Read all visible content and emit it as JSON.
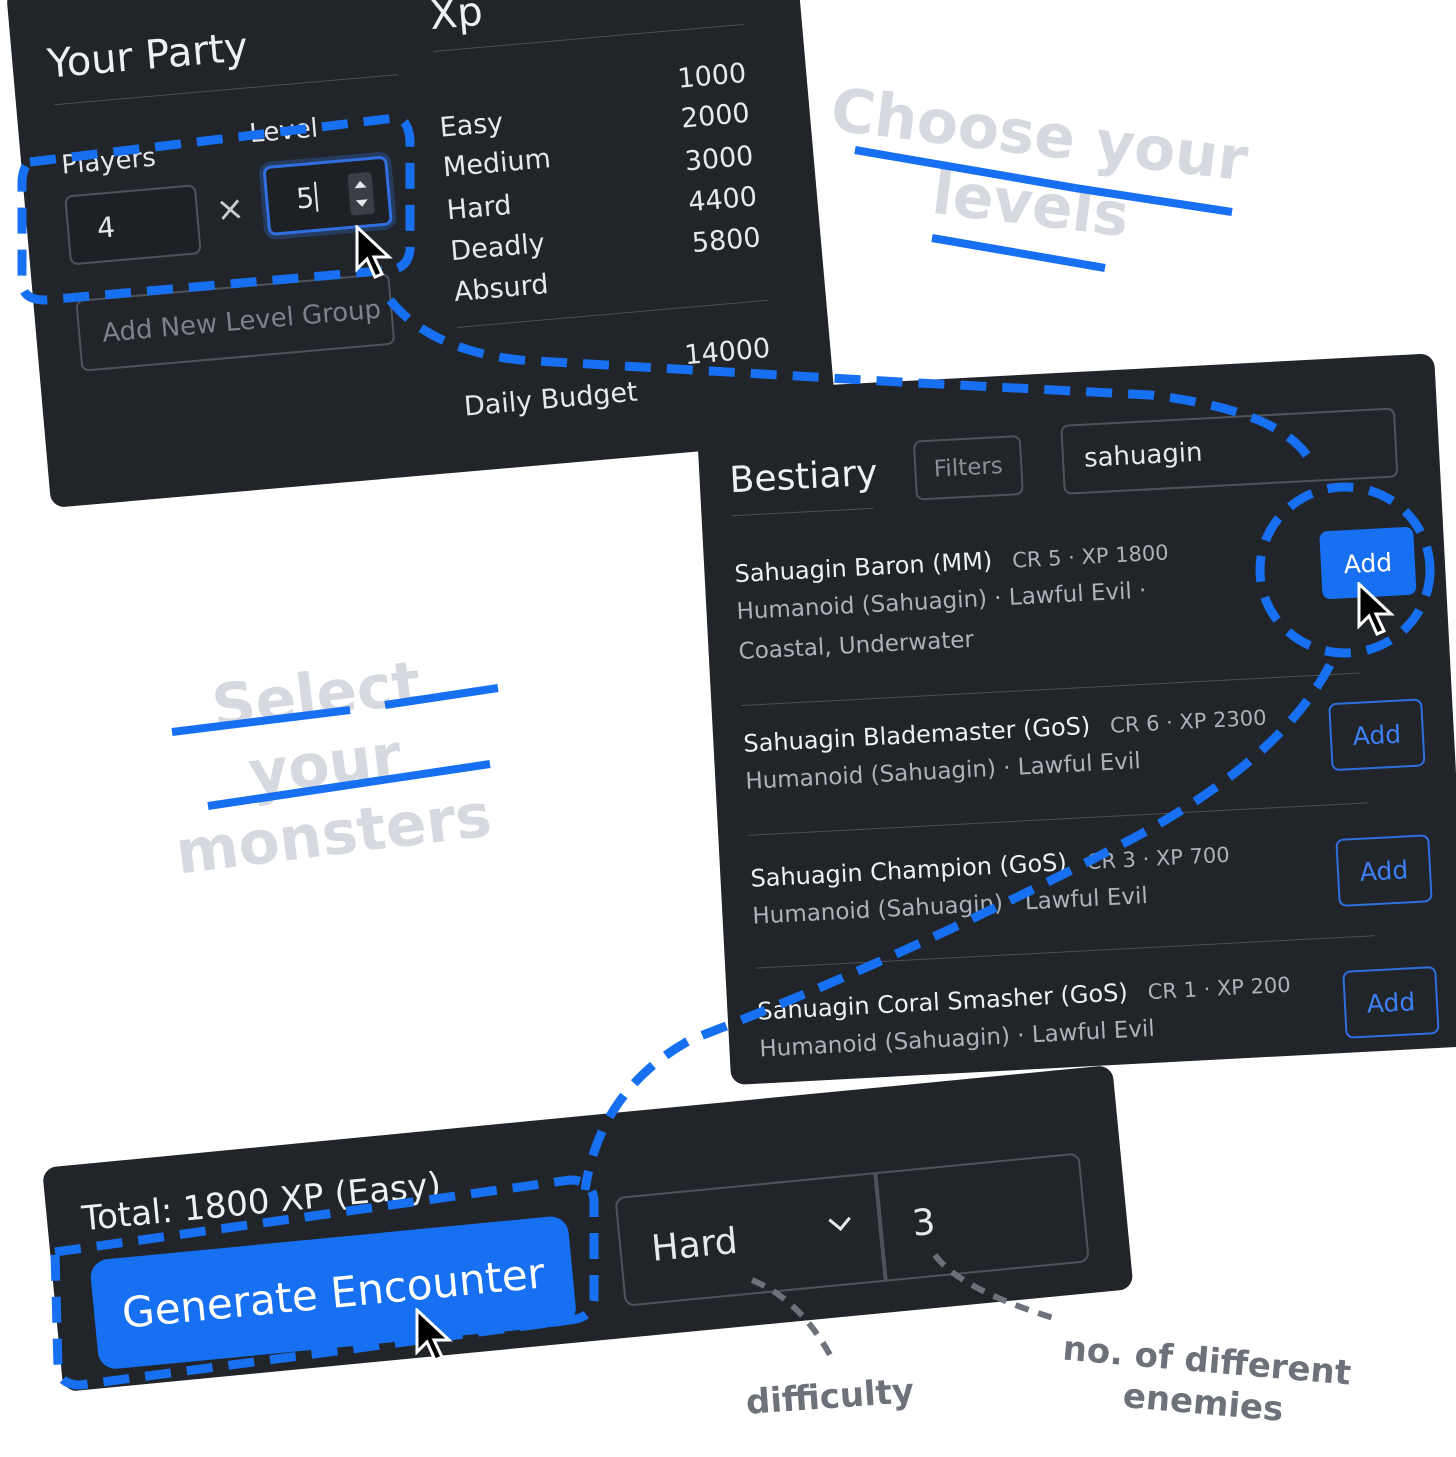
{
  "party": {
    "title": "Your Party",
    "players_label": "Players",
    "level_label": "Level",
    "players_value": "4",
    "level_value": "5",
    "times_symbol": "×",
    "add_level_group_label": "Add New Level Group"
  },
  "xp": {
    "title": "Xp",
    "rows": [
      {
        "label": "Easy",
        "value": "1000"
      },
      {
        "label": "Medium",
        "value": "2000"
      },
      {
        "label": "Hard",
        "value": "3000"
      },
      {
        "label": "Deadly",
        "value": "4400"
      },
      {
        "label": "Absurd",
        "value": "5800"
      }
    ],
    "daily_budget_label": "Daily Budget",
    "daily_budget_value": "14000"
  },
  "bestiary": {
    "title": "Bestiary",
    "filters_label": "Filters",
    "search_value": "sahuagin",
    "monsters": [
      {
        "name": "Sahuagin Baron (MM)",
        "cr_xp": "CR 5 · XP 1800",
        "desc": "Humanoid (Sahuagin) · Lawful Evil · Coastal, Underwater",
        "add_label": "Add",
        "primary": true
      },
      {
        "name": "Sahuagin Blademaster (GoS)",
        "cr_xp": "CR 6 · XP 2300",
        "desc": "Humanoid (Sahuagin) · Lawful Evil",
        "add_label": "Add"
      },
      {
        "name": "Sahuagin Champion (GoS)",
        "cr_xp": "CR 3 · XP 700",
        "desc": "Humanoid (Sahuagin) · Lawful Evil",
        "add_label": "Add"
      },
      {
        "name": "Sahuagin Coral Smasher (GoS)",
        "cr_xp": "CR 1 · XP 200",
        "desc": "Humanoid (Sahuagin) · Lawful Evil",
        "add_label": "Add"
      }
    ]
  },
  "encounter": {
    "total_text": "Total: 1800 XP (Easy)",
    "generate_label": "Generate Encounter",
    "difficulty_value": "Hard",
    "enemy_count_value": "3"
  },
  "annotations": {
    "choose_levels": "Choose your levels",
    "select_monsters": "Select your monsters",
    "difficulty": "difficulty",
    "no_of_enemies": "no. of different enemies"
  },
  "colors": {
    "panel_bg": "#212429",
    "accent_blue": "#1670f1",
    "annotation_gray": "#6d727a"
  }
}
